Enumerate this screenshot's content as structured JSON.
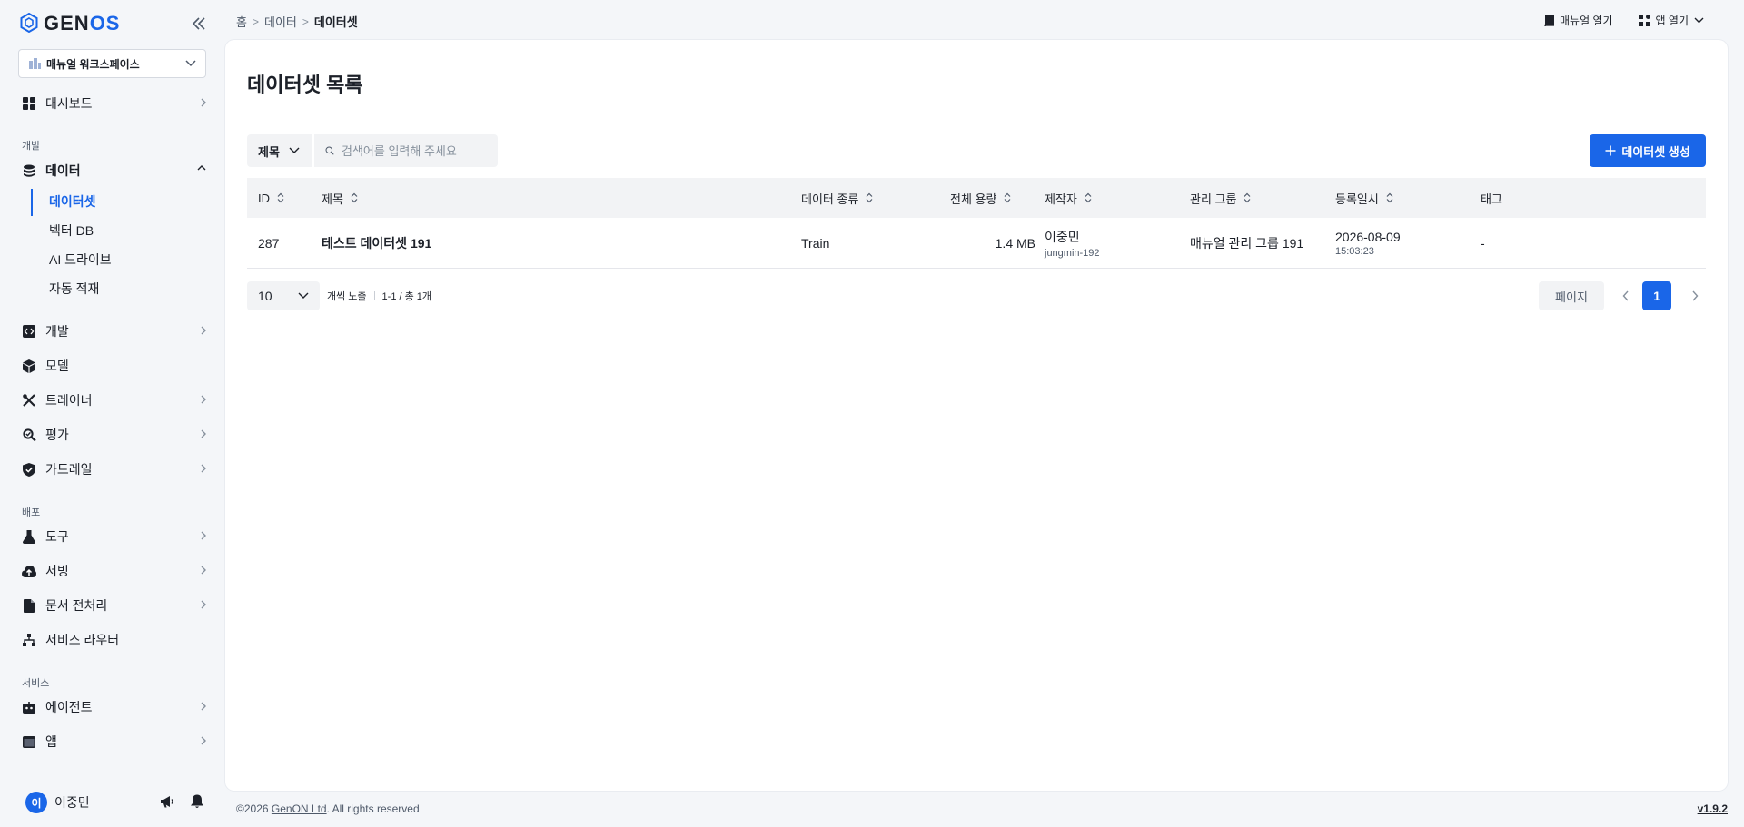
{
  "brand": {
    "logo_prefix": "GEN",
    "logo_suffix": "OS",
    "accent": "#1a66e8"
  },
  "workspace": {
    "name": "매뉴얼 워크스페이스"
  },
  "sidebar": {
    "items": [
      {
        "label": "대시보드",
        "icon": "dashboard-icon"
      },
      {
        "label": "데이터",
        "icon": "database-icon"
      },
      {
        "label": "개발",
        "icon": "code-icon"
      },
      {
        "label": "모델",
        "icon": "cube-icon"
      },
      {
        "label": "트레이너",
        "icon": "tools-icon"
      },
      {
        "label": "평가",
        "icon": "evaluate-icon"
      },
      {
        "label": "가드레일",
        "icon": "shield-icon"
      },
      {
        "label": "도구",
        "icon": "flask-icon"
      },
      {
        "label": "서빙",
        "icon": "cloud-upload-icon"
      },
      {
        "label": "문서 전처리",
        "icon": "document-icon"
      },
      {
        "label": "서비스 라우터",
        "icon": "network-icon"
      },
      {
        "label": "에이전트",
        "icon": "agent-icon"
      },
      {
        "label": "앱",
        "icon": "app-window-icon"
      }
    ],
    "sections": [
      "개발",
      "배포",
      "서비스"
    ],
    "data_sub": [
      "데이터셋",
      "벡터 DB",
      "AI 드라이브",
      "자동 적재"
    ]
  },
  "user": {
    "initial": "이",
    "name": "이중민"
  },
  "breadcrumb": [
    "홈",
    "데이터",
    "데이터셋"
  ],
  "header": {
    "manual": "매뉴얼 열기",
    "app": "앱 열기"
  },
  "page": {
    "title": "데이터셋 목록"
  },
  "filter": {
    "field": "제목",
    "placeholder": "검색어를 입력해 주세요"
  },
  "create_button": "데이터셋 생성",
  "table": {
    "columns": [
      "ID",
      "제목",
      "데이터 종류",
      "전체 용량",
      "제작자",
      "관리 그룹",
      "등록일시",
      "태그"
    ],
    "rows": [
      {
        "id": "287",
        "title": "테스트 데이터셋 191",
        "type": "Train",
        "size": "1.4 MB",
        "creator": "이중민",
        "creator_id": "jungmin-192",
        "group": "매뉴얼 관리 그룹 191",
        "date": "2026-08-09",
        "time": "15:03:23",
        "tag": "-"
      }
    ]
  },
  "pagination": {
    "page_size": "10",
    "per_page_label": "개씩 노출",
    "range": "1-1 / 총 1개",
    "page_input_label": "페이지",
    "current": "1"
  },
  "footer": {
    "copyright_prefix": "©2026",
    "company": "GenON Ltd",
    "rights": ". All rights reserved",
    "version": "v1.9.2"
  }
}
